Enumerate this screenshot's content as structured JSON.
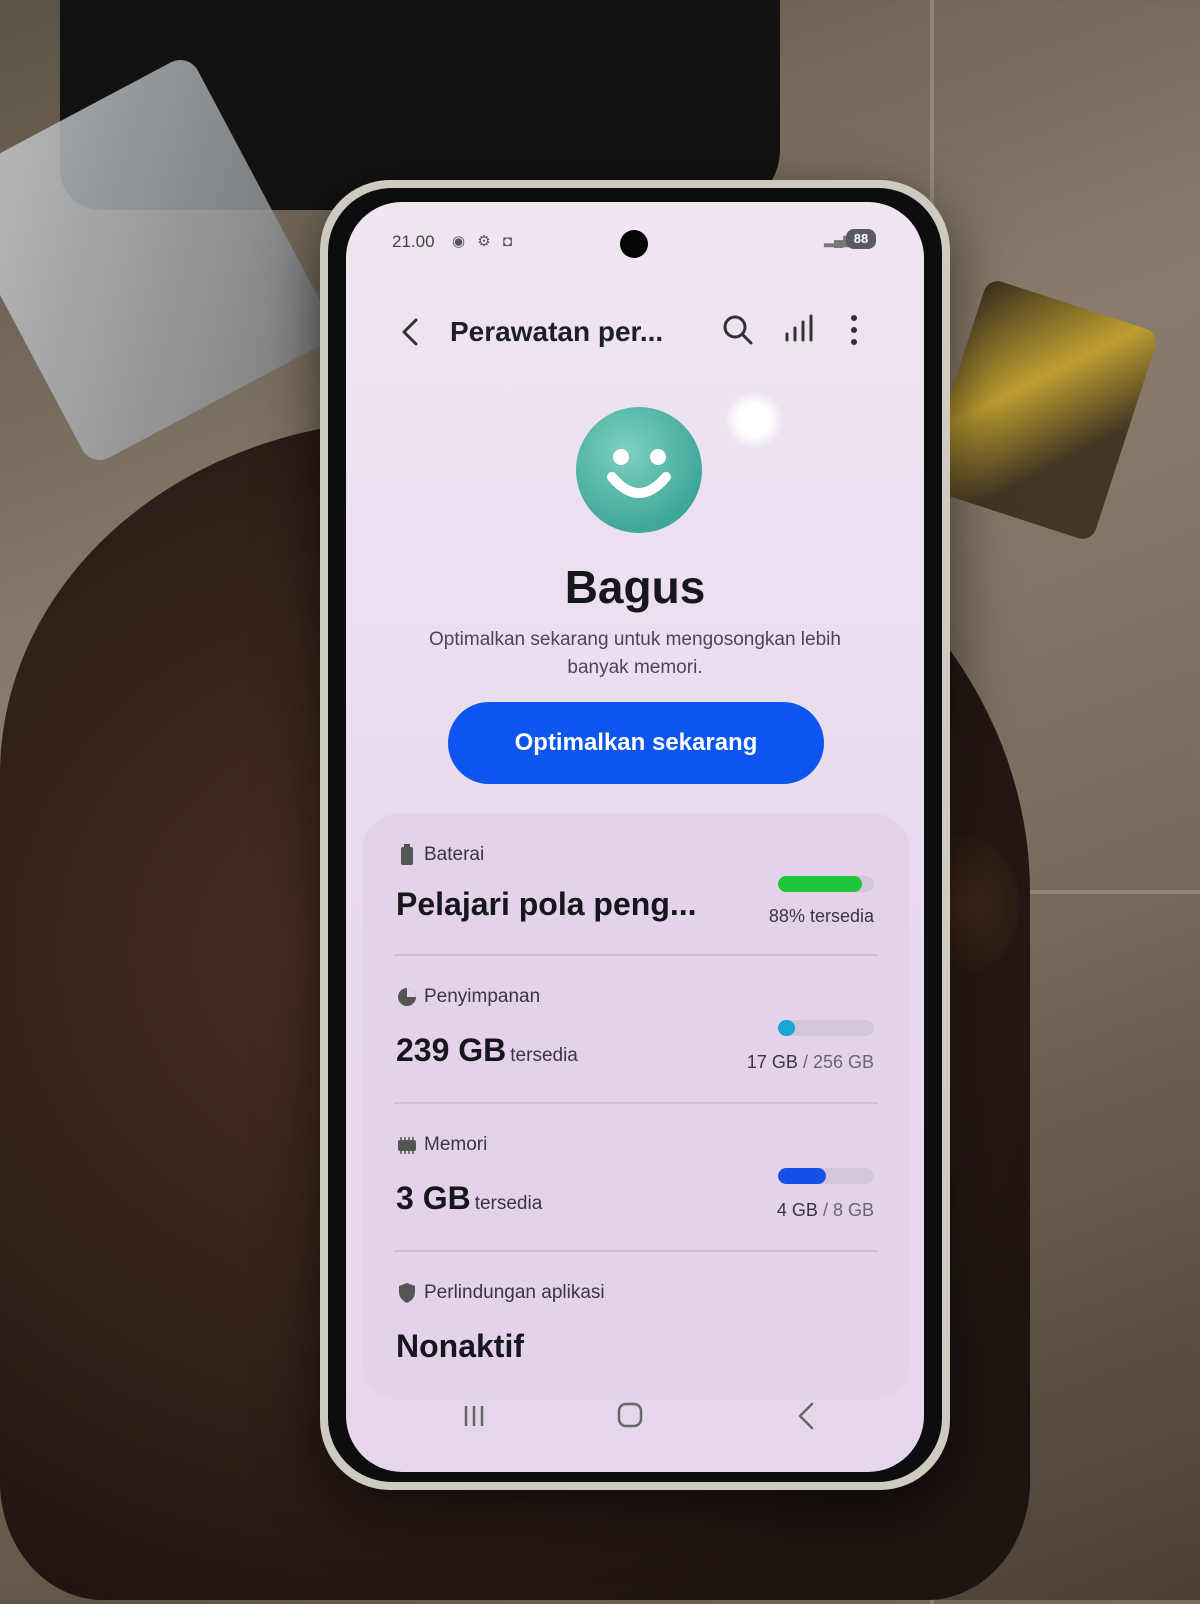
{
  "status_bar": {
    "time": "21.00",
    "icons": [
      "location-icon",
      "settings-icon",
      "shield-icon"
    ],
    "battery": "88"
  },
  "app_bar": {
    "title": "Perawatan per..."
  },
  "hero": {
    "status_title": "Bagus",
    "description": "Optimalkan sekarang untuk mengosongkan lebih banyak memori.",
    "button_label": "Optimalkan sekarang"
  },
  "card": {
    "battery": {
      "label": "Baterai",
      "value": "Pelajari pola peng...",
      "right_text": "88% tersedia",
      "level": 0.88,
      "color": "#1fc43a"
    },
    "storage": {
      "label": "Penyimpanan",
      "value": "239 GB",
      "value_suffix": "tersedia",
      "used": "17 GB",
      "total": "/ 256 GB",
      "level": 0.066,
      "color": "#1aa6d6"
    },
    "memory": {
      "label": "Memori",
      "value": "3 GB",
      "value_suffix": "tersedia",
      "used": "4 GB",
      "total": "/ 8 GB",
      "level": 0.5,
      "color": "#1550e8"
    },
    "app_protection": {
      "label": "Perlindungan aplikasi",
      "value": "Nonaktif"
    }
  },
  "colors": {
    "accent": "#0c55ee",
    "screen_background": "#ece0f0",
    "smiley": "#4fb8a6"
  }
}
